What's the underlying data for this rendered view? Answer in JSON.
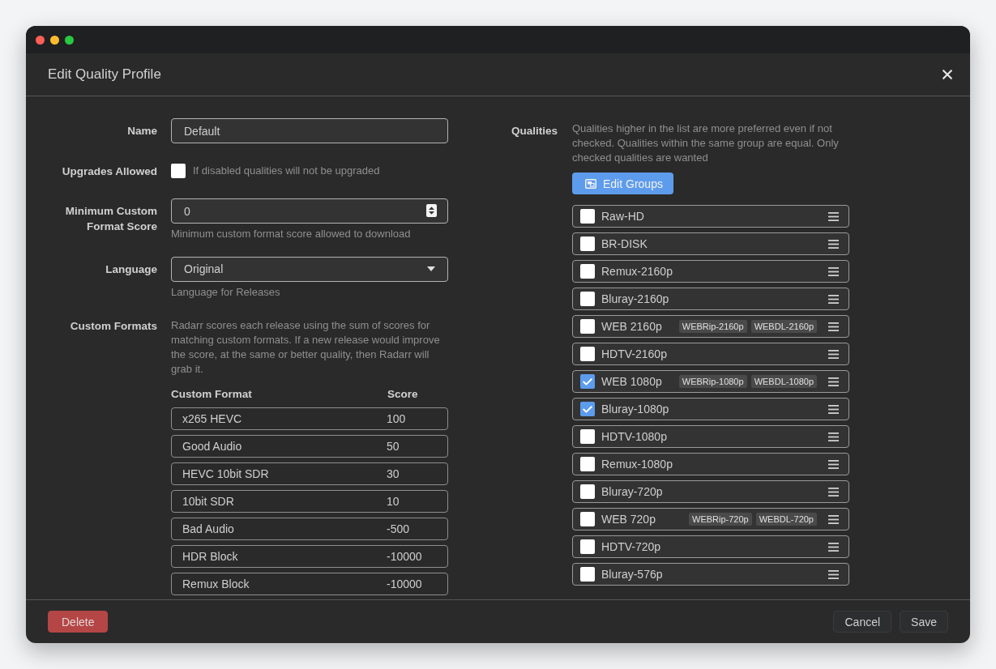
{
  "dialog": {
    "title": "Edit Quality Profile"
  },
  "form": {
    "name": {
      "label": "Name",
      "value": "Default"
    },
    "upgrades_allowed": {
      "label": "Upgrades Allowed",
      "checked": false,
      "help": "If disabled qualities will not be upgraded"
    },
    "minimum_custom_format_score": {
      "label": "Minimum Custom Format Score",
      "value": "0",
      "help": "Minimum custom format score allowed to download"
    },
    "language": {
      "label": "Language",
      "value": "Original",
      "help": "Language for Releases"
    },
    "custom_formats": {
      "label": "Custom Formats",
      "help": "Radarr scores each release using the sum of scores for matching custom formats. If a new release would improve the score, at the same or better quality, then Radarr will grab it.",
      "columns": [
        "Custom Format",
        "Score"
      ],
      "rows": [
        {
          "name": "x265 HEVC",
          "score": "100"
        },
        {
          "name": "Good Audio",
          "score": "50"
        },
        {
          "name": "HEVC 10bit SDR",
          "score": "30"
        },
        {
          "name": "10bit SDR",
          "score": "10"
        },
        {
          "name": "Bad Audio",
          "score": "-500"
        },
        {
          "name": "HDR Block",
          "score": "-10000"
        },
        {
          "name": "Remux Block",
          "score": "-10000"
        }
      ]
    }
  },
  "qualities": {
    "label": "Qualities",
    "help": "Qualities higher in the list are more preferred even if not checked. Qualities within the same group are equal. Only checked qualities are wanted",
    "edit_groups_button": "Edit Groups",
    "items": [
      {
        "name": "Raw-HD",
        "checked": false
      },
      {
        "name": "BR-DISK",
        "checked": false
      },
      {
        "name": "Remux-2160p",
        "checked": false
      },
      {
        "name": "Bluray-2160p",
        "checked": false
      },
      {
        "name": "WEB 2160p",
        "checked": false,
        "tags": [
          "WEBRip-2160p",
          "WEBDL-2160p"
        ]
      },
      {
        "name": "HDTV-2160p",
        "checked": false
      },
      {
        "name": "WEB 1080p",
        "checked": true,
        "tags": [
          "WEBRip-1080p",
          "WEBDL-1080p"
        ]
      },
      {
        "name": "Bluray-1080p",
        "checked": true
      },
      {
        "name": "HDTV-1080p",
        "checked": false
      },
      {
        "name": "Remux-1080p",
        "checked": false
      },
      {
        "name": "Bluray-720p",
        "checked": false
      },
      {
        "name": "WEB 720p",
        "checked": false,
        "tags": [
          "WEBRip-720p",
          "WEBDL-720p"
        ]
      },
      {
        "name": "HDTV-720p",
        "checked": false
      },
      {
        "name": "Bluray-576p",
        "checked": false
      }
    ]
  },
  "footer": {
    "buttons": [
      {
        "label": "Delete",
        "kind": "danger"
      },
      {
        "label": "Cancel",
        "kind": "default"
      },
      {
        "label": "Save",
        "kind": "default"
      }
    ]
  }
}
